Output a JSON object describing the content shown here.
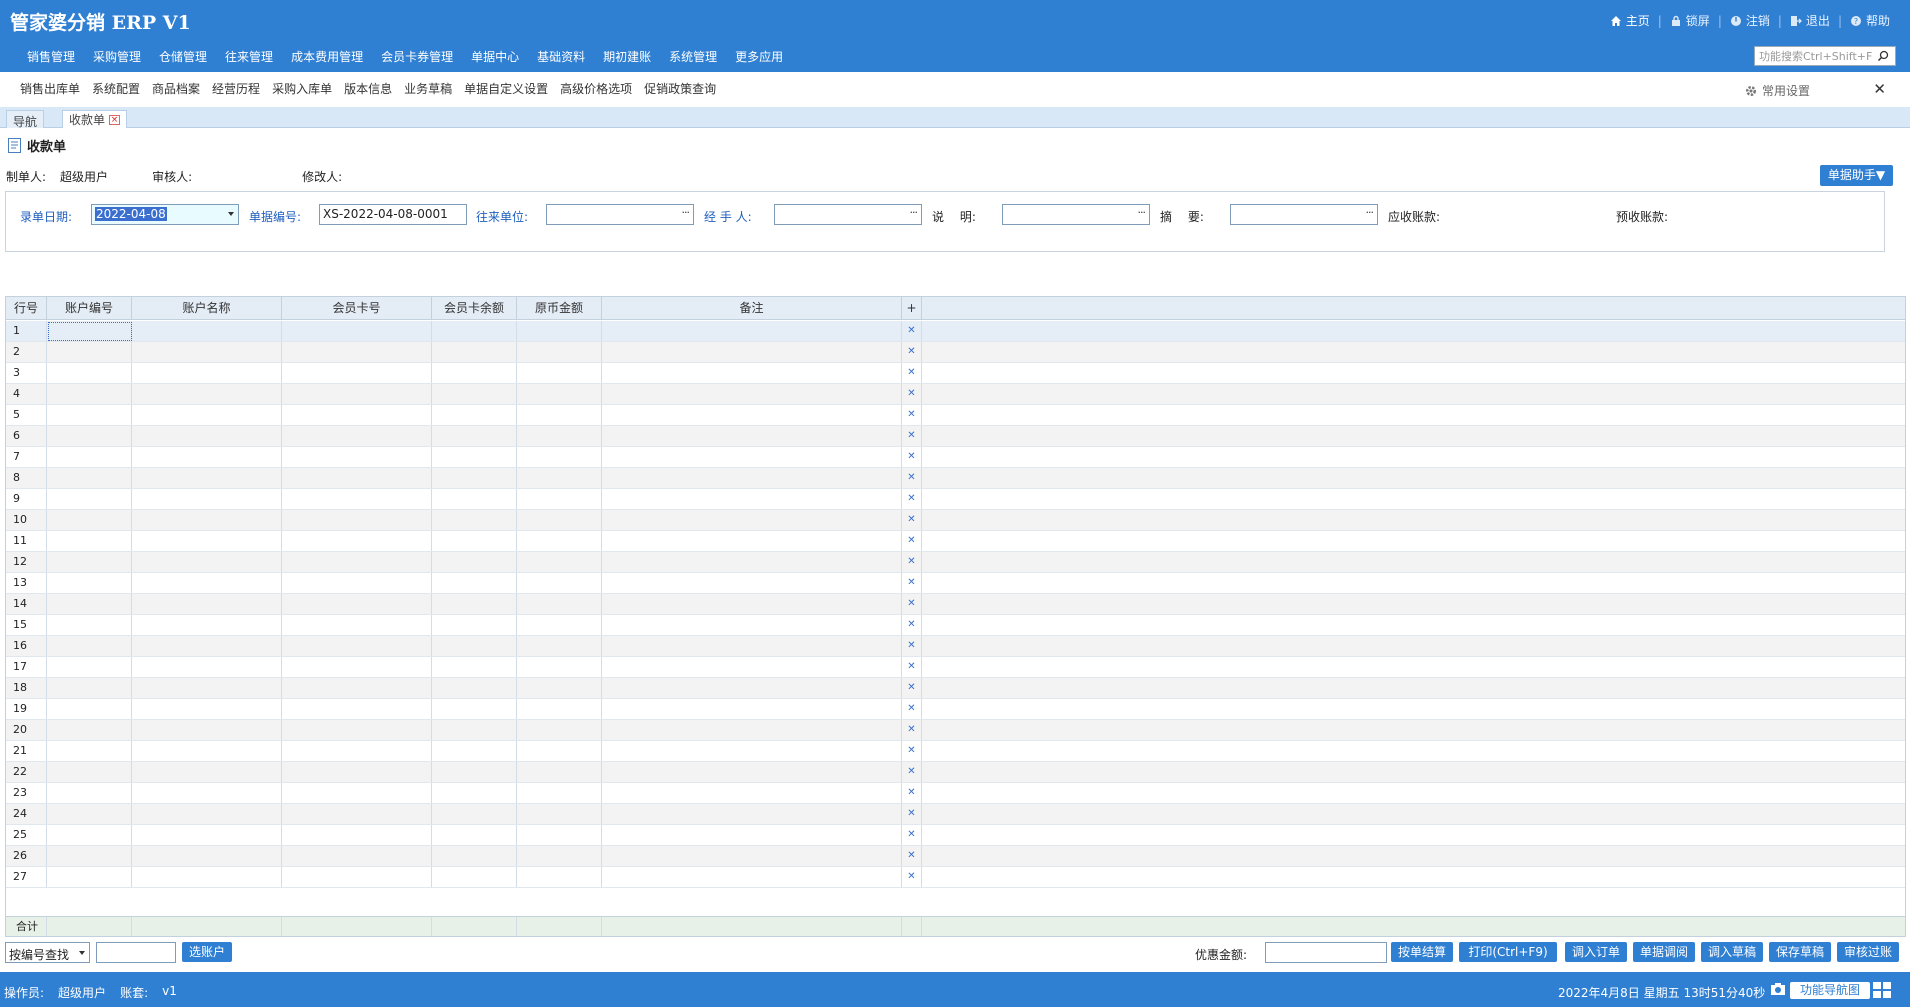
{
  "app": {
    "title": "管家婆分销 ERP V1"
  },
  "top_actions": [
    "主页",
    "锁屏",
    "注销",
    "退出",
    "帮助"
  ],
  "main_menu": [
    "销售管理",
    "采购管理",
    "仓储管理",
    "往来管理",
    "成本费用管理",
    "会员卡券管理",
    "单据中心",
    "基础资料",
    "期初建账",
    "系统管理",
    "更多应用"
  ],
  "search": {
    "placeholder": "功能搜索Ctrl+Shift+F"
  },
  "quick_links": [
    "销售出库单",
    "系统配置",
    "商品档案",
    "经营历程",
    "采购入库单",
    "版本信息",
    "业务草稿",
    "单据自定义设置",
    "高级价格选项",
    "促销政策查询"
  ],
  "common_settings": "常用设置",
  "tabs": {
    "nav": "导航",
    "doc": "收款单"
  },
  "page": {
    "title": "收款单",
    "creator_label": "制单人:",
    "creator": "超级用户",
    "auditor_label": "审核人:",
    "auditor": "",
    "modifier_label": "修改人:",
    "modifier": "",
    "helper_btn": "单据助手▼"
  },
  "form": {
    "date_label": "录单日期:",
    "date_value": "2022-04-08",
    "no_label": "单据编号:",
    "no_value": "XS-2022-04-08-0001",
    "partner_label": "往来单位:",
    "handler_label": "经 手 人:",
    "desc_label": "说　 明:",
    "summary_label": "摘　 要:",
    "receivable_label": "应收账款:",
    "prereceive_label": "预收账款:"
  },
  "grid": {
    "columns": [
      "行号",
      "账户编号",
      "账户名称",
      "会员卡号",
      "会员卡余额",
      "原币金额",
      "备注",
      "+"
    ],
    "row_count": 27,
    "rows": [
      "1",
      "2",
      "3",
      "4",
      "5",
      "6",
      "7",
      "8",
      "9",
      "10",
      "11",
      "12",
      "13",
      "14",
      "15",
      "16",
      "17",
      "18",
      "19",
      "20",
      "21",
      "22",
      "23",
      "24",
      "25",
      "26",
      "27"
    ],
    "total_label": "合计"
  },
  "bottom": {
    "lookup_select": "按编号查找",
    "choose_account_btn": "选账户",
    "discount_label": "优惠金额:",
    "buttons": [
      "按单结算",
      "打印(Ctrl+F9)",
      "调入订单",
      "单据调阅",
      "调入草稿",
      "保存草稿",
      "审核过账"
    ]
  },
  "status": {
    "operator_label": "操作员:",
    "operator": "超级用户",
    "book_label": "账套:",
    "book": "v1",
    "datetime": "2022年4月8日  星期五  13时51分40秒",
    "nav_map_btn": "功能导航图"
  },
  "colors": {
    "primary": "#2f7fd3",
    "label_blue": "#1f5fbf"
  }
}
